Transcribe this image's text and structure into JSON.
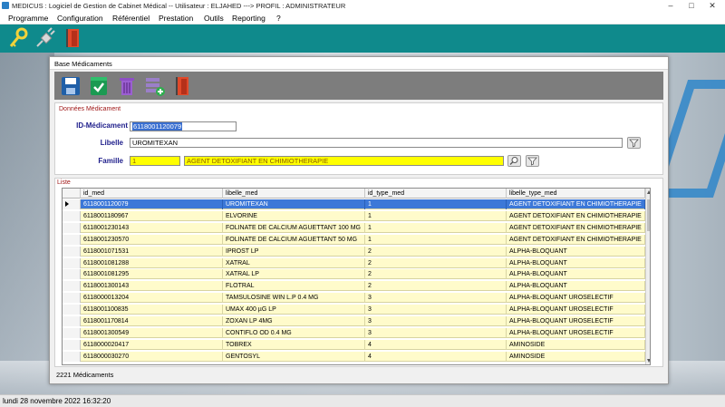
{
  "window": {
    "title": "MEDICUS : Logiciel de Gestion de Cabinet Médical -- Utilisateur : ELJAHED ---> PROFIL : ADMINISTRATEUR",
    "minimize": "–",
    "maximize": "□",
    "close": "✕"
  },
  "menu": {
    "items": [
      "Programme",
      "Configuration",
      "Référentiel",
      "Prestation",
      "Outils",
      "Reporting",
      "?"
    ]
  },
  "main_toolbar": {
    "icons": [
      "key-icon",
      "plug-icon",
      "exit-door-icon"
    ]
  },
  "child_window": {
    "title": "Base Médicaments",
    "toolbar_icons": [
      "save-icon",
      "validate-icon",
      "delete-icon",
      "add-list-icon",
      "exit-door-icon"
    ],
    "form": {
      "legend": "Données Médicament",
      "id_label": "ID-Médicament",
      "id_value": "6118001120079",
      "libelle_label": "Libelle",
      "libelle_value": "UROMITEXAN",
      "famille_label": "Famille",
      "famille_code": "1",
      "famille_name": "AGENT DETOXIFIANT EN CHIMIOTHERAPIE"
    },
    "list": {
      "legend": "Liste",
      "columns": [
        "id_med",
        "libelle_med",
        "id_type_med",
        "libelle_type_med"
      ],
      "rows": [
        [
          "6118001120079",
          "UROMITEXAN",
          "1",
          "AGENT DETOXIFIANT EN CHIMIOTHERAPIE"
        ],
        [
          "6118001180967",
          "ELVORINE",
          "1",
          "AGENT DETOXIFIANT EN CHIMIOTHERAPIE"
        ],
        [
          "6118001230143",
          "FOLINATE DE CALCIUM AGUETTANT 100 MG",
          "1",
          "AGENT DETOXIFIANT EN CHIMIOTHERAPIE"
        ],
        [
          "6118001230570",
          "FOLINATE DE CALCIUM AGUETTANT 50 MG",
          "1",
          "AGENT DETOXIFIANT EN CHIMIOTHERAPIE"
        ],
        [
          "6118001071531",
          "IPROST LP",
          "2",
          "ALPHA-BLOQUANT"
        ],
        [
          "6118001081288",
          "XATRAL",
          "2",
          "ALPHA-BLOQUANT"
        ],
        [
          "6118001081295",
          "XATRAL LP",
          "2",
          "ALPHA-BLOQUANT"
        ],
        [
          "6118001300143",
          "FLOTRAL",
          "2",
          "ALPHA-BLOQUANT"
        ],
        [
          "6118000013204",
          "TAMSULOSINE WIN L.P 0.4 MG",
          "3",
          "ALPHA-BLOQUANT UROSELECTIF"
        ],
        [
          "6118001100835",
          "UMAX 400 µG LP",
          "3",
          "ALPHA-BLOQUANT UROSELECTIF"
        ],
        [
          "6118001170814",
          "ZOXAN LP 4MG",
          "3",
          "ALPHA-BLOQUANT UROSELECTIF"
        ],
        [
          "6118001300549",
          "CONTIFLO OD 0.4 MG",
          "3",
          "ALPHA-BLOQUANT UROSELECTIF"
        ],
        [
          "6118000020417",
          "TOBREX",
          "4",
          "AMINOSIDE"
        ],
        [
          "6118000030270",
          "GENTOSYL",
          "4",
          "AMINOSIDE"
        ]
      ],
      "selected_row": 0
    },
    "count_label": "2221  Médicaments"
  },
  "status": {
    "datetime": "lundi 28 novembre 2022   16:32:20"
  },
  "colors": {
    "toolbar": "#0f8a8c",
    "grid_row": "#fffbcb",
    "selected_row": "#3c78d8",
    "label": "#20208c",
    "yellow_input": "#ffff00"
  }
}
